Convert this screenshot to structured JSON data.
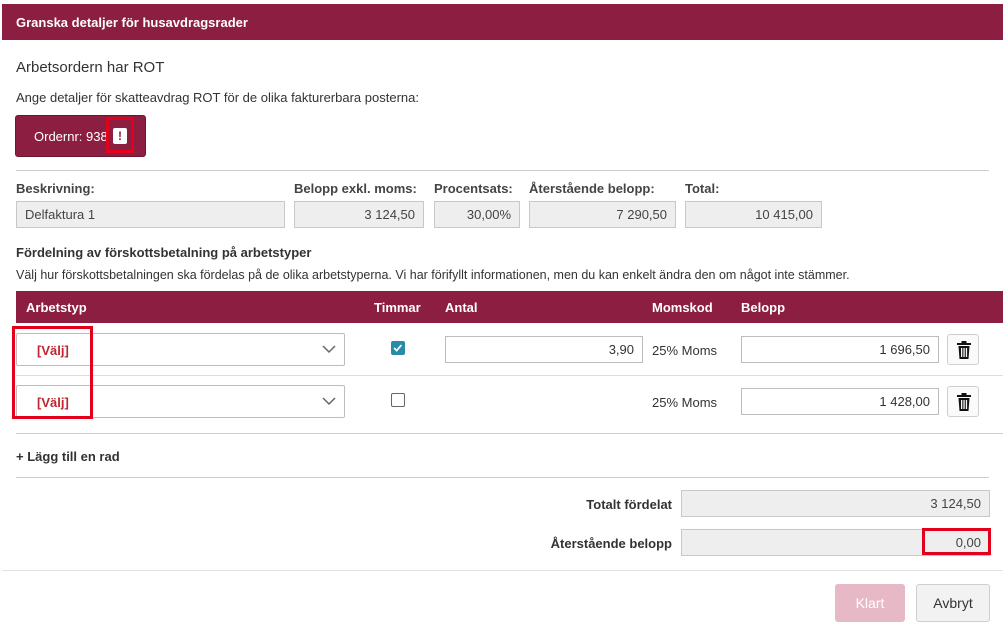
{
  "dialog": {
    "title": "Granska detaljer för husavdragsrader"
  },
  "intro": {
    "heading": "Arbetsordern har ROT",
    "description": "Ange detaljer för skatteavdrag ROT för de olika fakturerbara posterna:"
  },
  "order": {
    "label": "Ordernr: 938",
    "alert": "!"
  },
  "summary": {
    "description_label": "Beskrivning:",
    "description_value": "Delfaktura 1",
    "amount_label": "Belopp exkl. moms:",
    "amount_value": "3 124,50",
    "percent_label": "Procentsats:",
    "percent_value": "30,00%",
    "remaining_label": "Återstående belopp:",
    "remaining_value": "7 290,50",
    "total_label": "Total:",
    "total_value": "10 415,00"
  },
  "distribution": {
    "title": "Fördelning av förskottsbetalning på arbetstyper",
    "description": "Välj hur förskottsbetalningen ska fördelas på de olika arbetstyperna. Vi har förifyllt informationen, men du kan enkelt ändra den om något inte stämmer."
  },
  "table": {
    "headers": {
      "work_type": "Arbetstyp",
      "hours": "Timmar",
      "quantity": "Antal",
      "vat_code": "Momskod",
      "amount": "Belopp"
    },
    "rows": [
      {
        "work_type": "[Välj]",
        "hours_checked": true,
        "quantity": "3,90",
        "vat_code": "25% Moms",
        "amount": "1 696,50"
      },
      {
        "work_type": "[Välj]",
        "hours_checked": false,
        "quantity": "",
        "vat_code": "25% Moms",
        "amount": "1 428,00"
      }
    ]
  },
  "add_row": {
    "label": "+ Lägg till en rad"
  },
  "totals": {
    "total_distributed_label": "Totalt fördelat",
    "total_distributed_value": "3 124,50",
    "remaining_label": "Återstående belopp",
    "remaining_value": "0,00"
  },
  "buttons": {
    "done": "Klart",
    "cancel": "Avbryt"
  },
  "colors": {
    "brand": "#8b1e41",
    "highlight": "#e2001a",
    "select_text": "#c0252f",
    "checkbox": "#2a8aa8"
  }
}
